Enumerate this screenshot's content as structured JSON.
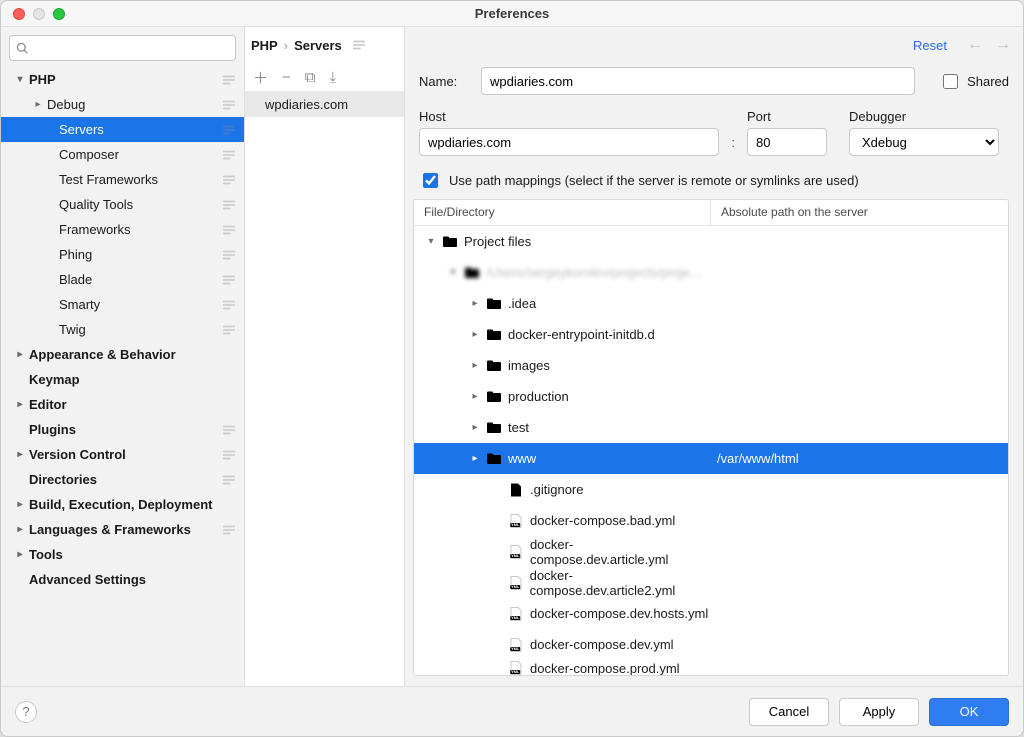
{
  "window": {
    "title": "Preferences"
  },
  "search": {
    "placeholder": ""
  },
  "nav": [
    {
      "label": "PHP",
      "depth": 0,
      "arrow": "down",
      "gear": true
    },
    {
      "label": "Debug",
      "depth": 1,
      "arrow": "right",
      "gear": true
    },
    {
      "label": "Servers",
      "depth": 2,
      "arrow": "",
      "gear": true,
      "selected": true
    },
    {
      "label": "Composer",
      "depth": 2,
      "arrow": "",
      "gear": true
    },
    {
      "label": "Test Frameworks",
      "depth": 2,
      "arrow": "",
      "gear": true
    },
    {
      "label": "Quality Tools",
      "depth": 2,
      "arrow": "",
      "gear": true
    },
    {
      "label": "Frameworks",
      "depth": 2,
      "arrow": "",
      "gear": true
    },
    {
      "label": "Phing",
      "depth": 2,
      "arrow": "",
      "gear": true
    },
    {
      "label": "Blade",
      "depth": 2,
      "arrow": "",
      "gear": true
    },
    {
      "label": "Smarty",
      "depth": 2,
      "arrow": "",
      "gear": true
    },
    {
      "label": "Twig",
      "depth": 2,
      "arrow": "",
      "gear": true
    },
    {
      "label": "Appearance & Behavior",
      "depth": 0,
      "arrow": "right"
    },
    {
      "label": "Keymap",
      "depth": 0,
      "arrow": ""
    },
    {
      "label": "Editor",
      "depth": 0,
      "arrow": "right"
    },
    {
      "label": "Plugins",
      "depth": 0,
      "arrow": "",
      "gear": true
    },
    {
      "label": "Version Control",
      "depth": 0,
      "arrow": "right",
      "gear": true
    },
    {
      "label": "Directories",
      "depth": 0,
      "arrow": "",
      "gear": true
    },
    {
      "label": "Build, Execution, Deployment",
      "depth": 0,
      "arrow": "right"
    },
    {
      "label": "Languages & Frameworks",
      "depth": 0,
      "arrow": "right",
      "gear": true
    },
    {
      "label": "Tools",
      "depth": 0,
      "arrow": "right"
    },
    {
      "label": "Advanced Settings",
      "depth": 0,
      "arrow": ""
    }
  ],
  "breadcrumb": {
    "a": "PHP",
    "b": "Servers"
  },
  "mid_toolbar": {
    "add": "＋",
    "remove": "−",
    "copy": "⧉",
    "import": "⤓"
  },
  "servers": [
    "wpdiaries.com"
  ],
  "pane_header": {
    "reset": "Reset"
  },
  "form": {
    "name_label": "Name:",
    "name_value": "wpdiaries.com",
    "shared_label": "Shared",
    "host_label": "Host",
    "host_value": "wpdiaries.com",
    "port_label": "Port",
    "port_value": "80",
    "debugger_label": "Debugger",
    "debugger_value": "Xdebug",
    "mappings_label": "Use path mappings (select if the server is remote or symlinks are used)"
  },
  "map_head": {
    "left": "File/Directory",
    "right": "Absolute path on the server"
  },
  "files": [
    {
      "ind": 0,
      "arrow": "down",
      "kind": "folder",
      "label": "Project files"
    },
    {
      "ind": 1,
      "arrow": "down",
      "kind": "folder",
      "label": "/Users/sergeykorolev/projects/proje…",
      "blurred": true
    },
    {
      "ind": 2,
      "arrow": "right",
      "kind": "folder",
      "label": ".idea"
    },
    {
      "ind": 2,
      "arrow": "right",
      "kind": "folder",
      "label": "docker-entrypoint-initdb.d"
    },
    {
      "ind": 2,
      "arrow": "right",
      "kind": "folder",
      "label": "images"
    },
    {
      "ind": 2,
      "arrow": "right",
      "kind": "folder",
      "label": "production"
    },
    {
      "ind": 2,
      "arrow": "right",
      "kind": "folder",
      "label": "test"
    },
    {
      "ind": 2,
      "arrow": "right",
      "kind": "folder",
      "label": "www",
      "selected": true,
      "path": "/var/www/html"
    },
    {
      "ind": 3,
      "arrow": "",
      "kind": "file",
      "label": ".gitignore"
    },
    {
      "ind": 3,
      "arrow": "",
      "kind": "yml",
      "label": "docker-compose.bad.yml"
    },
    {
      "ind": 3,
      "arrow": "",
      "kind": "yml",
      "label": "docker-compose.dev.article.yml"
    },
    {
      "ind": 3,
      "arrow": "",
      "kind": "yml",
      "label": "docker-compose.dev.article2.yml"
    },
    {
      "ind": 3,
      "arrow": "",
      "kind": "yml",
      "label": "docker-compose.dev.hosts.yml"
    },
    {
      "ind": 3,
      "arrow": "",
      "kind": "yml",
      "label": "docker-compose.dev.yml"
    },
    {
      "ind": 3,
      "arrow": "",
      "kind": "yml",
      "label": "docker-compose.prod.yml",
      "cut": true
    }
  ],
  "footer": {
    "cancel": "Cancel",
    "apply": "Apply",
    "ok": "OK"
  }
}
